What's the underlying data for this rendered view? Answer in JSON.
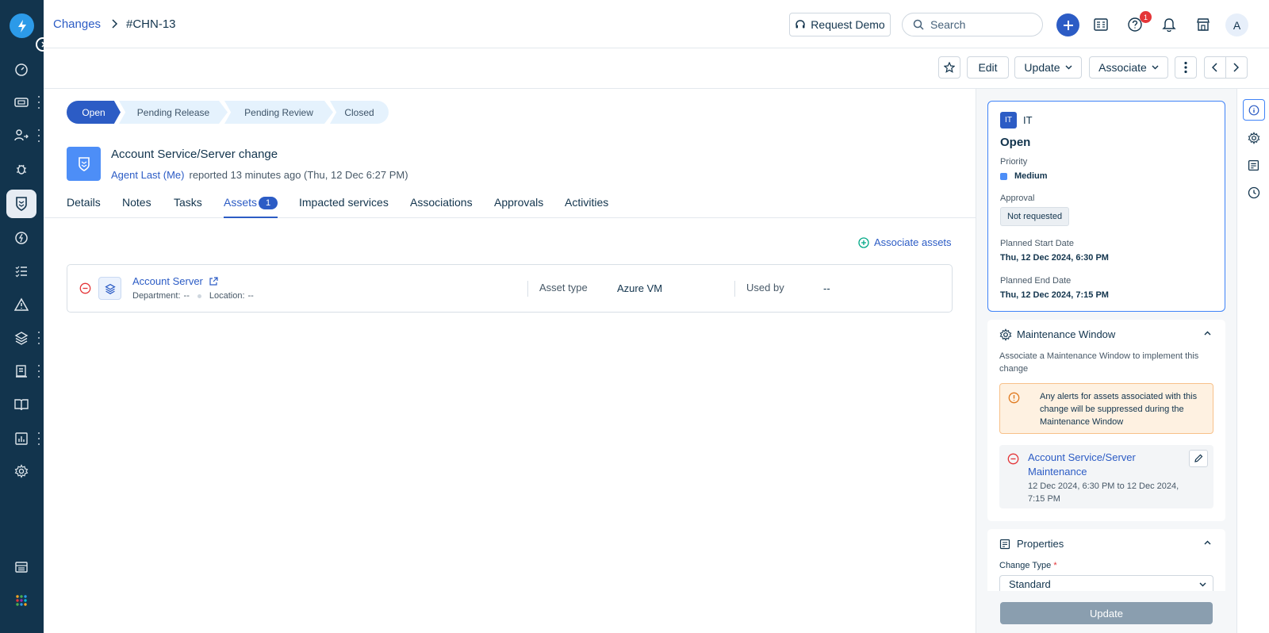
{
  "breadcrumb": {
    "parent": "Changes",
    "current": "#CHN-13"
  },
  "header": {
    "request_demo_label": "Request Demo",
    "search_placeholder": "Search",
    "help_badge_count": "1",
    "avatar_initial": "A"
  },
  "actions": {
    "edit_label": "Edit",
    "update_label": "Update",
    "associate_label": "Associate"
  },
  "stages": [
    "Open",
    "Pending Release",
    "Pending Review",
    "Closed"
  ],
  "ticket": {
    "title": "Account Service/Server change",
    "requester": "Agent Last (Me)",
    "reported_text": "reported 13 minutes ago (Thu, 12 Dec 6:27 PM)"
  },
  "tabs": [
    {
      "label": "Details"
    },
    {
      "label": "Notes"
    },
    {
      "label": "Tasks"
    },
    {
      "label": "Assets",
      "count": "1"
    },
    {
      "label": "Impacted services"
    },
    {
      "label": "Associations"
    },
    {
      "label": "Approvals"
    },
    {
      "label": "Activities"
    }
  ],
  "assets": {
    "associate_label": "Associate assets",
    "items": [
      {
        "name": "Account Server",
        "department_label": "Department:",
        "department_value": "--",
        "location_label": "Location:",
        "location_value": "--",
        "asset_type_label": "Asset type",
        "asset_type_value": "Azure VM",
        "used_by_label": "Used by",
        "used_by_value": "--"
      }
    ]
  },
  "summary": {
    "workspace_badge": "IT",
    "workspace_name": "IT",
    "status": "Open",
    "priority_label": "Priority",
    "priority_value": "Medium",
    "priority_color": "#4d8ef7",
    "approval_label": "Approval",
    "approval_value": "Not requested",
    "planned_start_label": "Planned Start Date",
    "planned_start_value": "Thu, 12 Dec 2024, 6:30 PM",
    "planned_end_label": "Planned End Date",
    "planned_end_value": "Thu, 12 Dec 2024, 7:15 PM"
  },
  "maintenance": {
    "title": "Maintenance Window",
    "description": "Associate a Maintenance Window to implement this change",
    "alert_text": "Any alerts for assets associated with this change will be suppressed during the Maintenance Window",
    "window_name": "Account Service/Server Maintenance",
    "window_range": "12 Dec 2024, 6:30 PM to 12 Dec 2024, 7:15 PM"
  },
  "properties": {
    "title": "Properties",
    "change_type_label": "Change Type",
    "required_mark": "*",
    "change_type_value": "Standard",
    "update_button": "Update"
  },
  "colors": {
    "nav_bg": "#12344d",
    "accent": "#2c5cc5",
    "alert_bg": "#fef1e1",
    "alert_border": "#f8c18a",
    "danger": "#e43538"
  }
}
